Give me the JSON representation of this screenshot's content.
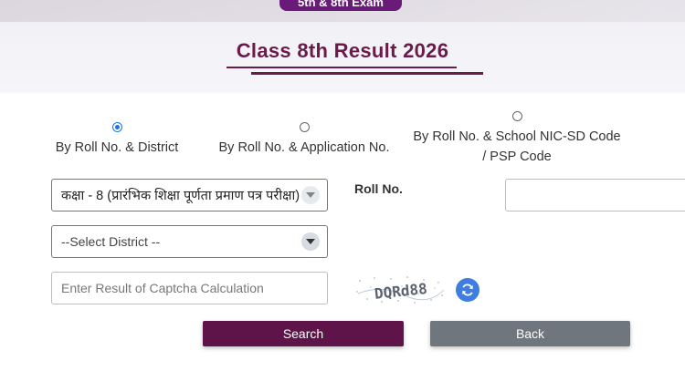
{
  "header": {
    "exam_badge": "5th & 8th Exam",
    "title": "Class 8th Result 2026"
  },
  "search_modes": [
    {
      "label": "By Roll No. & District",
      "selected": true
    },
    {
      "label": "By Roll No. & Application No.",
      "selected": false
    },
    {
      "label_line1": "By Roll No. & School NIC-SD Code",
      "label_line2": "/ PSP Code",
      "selected": false
    }
  ],
  "form": {
    "exam_select_value": "कक्षा - 8 (प्रारंभिक शिक्षा पूर्णता प्रमाण पत्र परीक्षा)",
    "district_select_value": "--Select District --",
    "roll_label": "Roll No.",
    "roll_value": "",
    "captcha_placeholder": "Enter Result of Captcha Calculation",
    "captcha_text": "DQRd88"
  },
  "buttons": {
    "search": "Search",
    "back": "Back"
  },
  "colors": {
    "title": "#6b1a4a",
    "search_button": "#5e1448",
    "back_button": "#6f767d",
    "radio_selected": "#1a73e8",
    "refresh_button": "#3f7de0"
  },
  "icons": {
    "dropdown": "chevron-down-icon",
    "refresh": "refresh-icon"
  }
}
